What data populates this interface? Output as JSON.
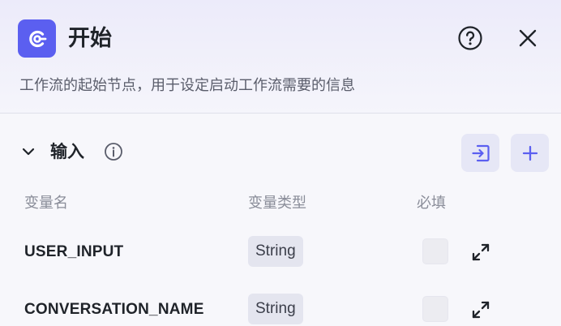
{
  "header": {
    "title": "开始",
    "description": "工作流的起始节点，用于设定启动工作流需要的信息",
    "accent_color": "#5b5ff0"
  },
  "input_section": {
    "title": "输入",
    "columns": {
      "name": "变量名",
      "type": "变量类型",
      "required": "必填"
    },
    "rows": [
      {
        "name": "USER_INPUT",
        "type": "String",
        "required": false
      },
      {
        "name": "CONVERSATION_NAME",
        "type": "String",
        "required": false
      }
    ]
  },
  "icons": {
    "logo": "start-node-icon",
    "help": "question-circle-icon",
    "close": "close-icon",
    "collapse": "chevron-down-icon",
    "info": "info-circle-icon",
    "import": "import-icon",
    "add": "plus-icon",
    "expand": "expand-icon"
  }
}
